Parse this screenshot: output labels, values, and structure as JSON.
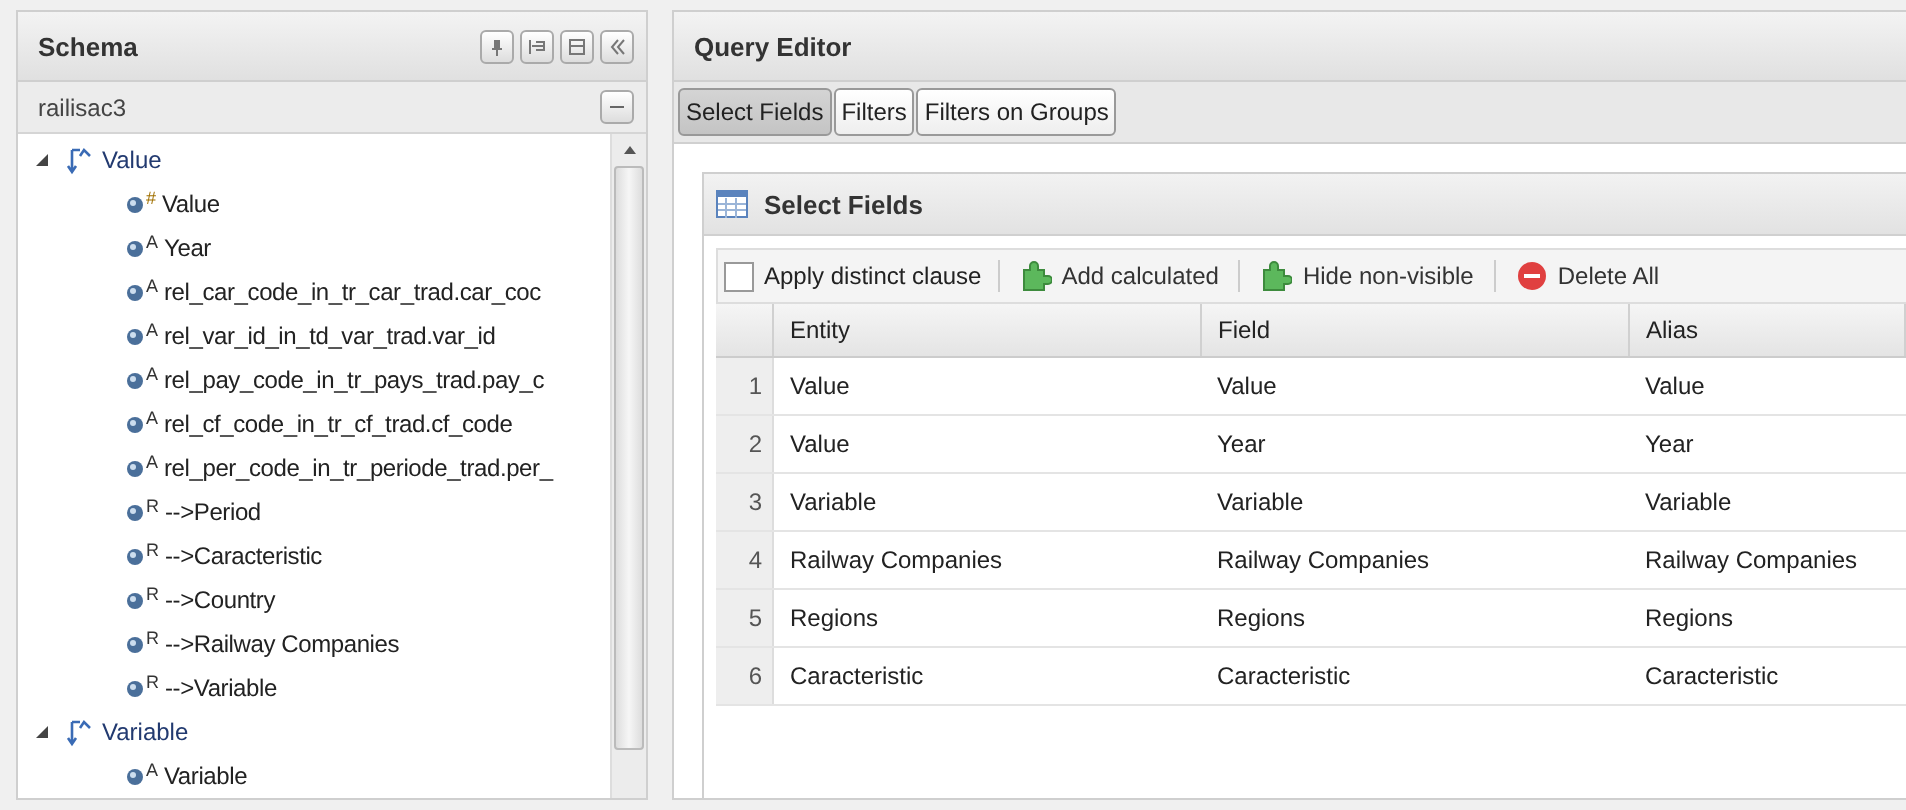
{
  "schema_panel": {
    "title": "Schema",
    "database": "railisac3",
    "tree": [
      {
        "label": "Value",
        "expanded": true,
        "children": [
          {
            "marker": "#",
            "label": "Value"
          },
          {
            "marker": "A",
            "label": "Year"
          },
          {
            "marker": "A",
            "label": "rel_car_code_in_tr_car_trad.car_coc"
          },
          {
            "marker": "A",
            "label": "rel_var_id_in_td_var_trad.var_id"
          },
          {
            "marker": "A",
            "label": "rel_pay_code_in_tr_pays_trad.pay_c"
          },
          {
            "marker": "A",
            "label": "rel_cf_code_in_tr_cf_trad.cf_code"
          },
          {
            "marker": "A",
            "label": "rel_per_code_in_tr_periode_trad.per_"
          },
          {
            "marker": "R",
            "label": "-->Period"
          },
          {
            "marker": "R",
            "label": "-->Caracteristic"
          },
          {
            "marker": "R",
            "label": "-->Country"
          },
          {
            "marker": "R",
            "label": "-->Railway Companies"
          },
          {
            "marker": "R",
            "label": "-->Variable"
          }
        ]
      },
      {
        "label": "Variable",
        "expanded": true,
        "children": [
          {
            "marker": "A",
            "label": "Variable"
          }
        ]
      }
    ]
  },
  "query_editor": {
    "title": "Query Editor",
    "tabs": [
      {
        "label": "Select Fields",
        "selected": true
      },
      {
        "label": "Filters",
        "selected": false
      },
      {
        "label": "Filters on Groups",
        "selected": false
      }
    ],
    "select_fields": {
      "title": "Select Fields",
      "toolbar": {
        "distinct": {
          "label": "Apply distinct clause",
          "checked": false
        },
        "buttons": [
          {
            "kind": "add",
            "label": "Add calculated"
          },
          {
            "kind": "hide",
            "label": "Hide non-visible"
          },
          {
            "kind": "delete",
            "label": "Delete All"
          }
        ]
      },
      "table": {
        "columns": [
          "Entity",
          "Field",
          "Alias"
        ],
        "rows": [
          {
            "number": "1",
            "cells": [
              "Value",
              "Value",
              "Value"
            ]
          },
          {
            "number": "2",
            "cells": [
              "Value",
              "Year",
              "Year"
            ]
          },
          {
            "number": "3",
            "cells": [
              "Variable",
              "Variable",
              "Variable"
            ]
          },
          {
            "number": "4",
            "cells": [
              "Railway Companies",
              "Railway Companies",
              "Railway Companies"
            ]
          },
          {
            "number": "5",
            "cells": [
              "Regions",
              "Regions",
              "Regions"
            ]
          },
          {
            "number": "6",
            "cells": [
              "Caracteristic",
              "Caracteristic",
              "Caracteristic"
            ]
          }
        ]
      }
    }
  }
}
